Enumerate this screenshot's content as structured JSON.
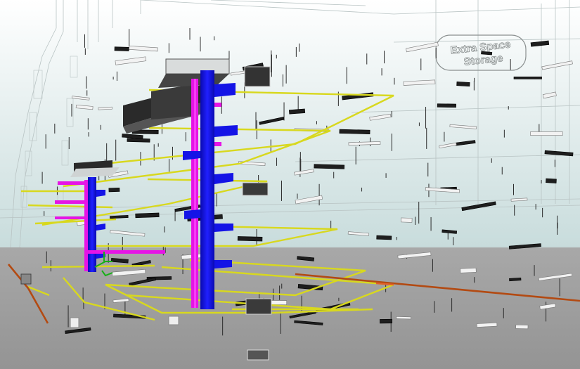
{
  "building_sign": {
    "line1": "Extra Space",
    "line2": "Storage"
  },
  "colors": {
    "sky_top": "#ffffff",
    "sky_bottom": "#c8dcdc",
    "ground": "#9e9e9e",
    "ductwork": "#1414e6",
    "riser_pipe": "#e614e6",
    "cable_tray": "#d8d81e",
    "sprinkler_main": "#b34a12",
    "hangers": "#2b2b2b",
    "equipment": "#3a3a3a"
  }
}
